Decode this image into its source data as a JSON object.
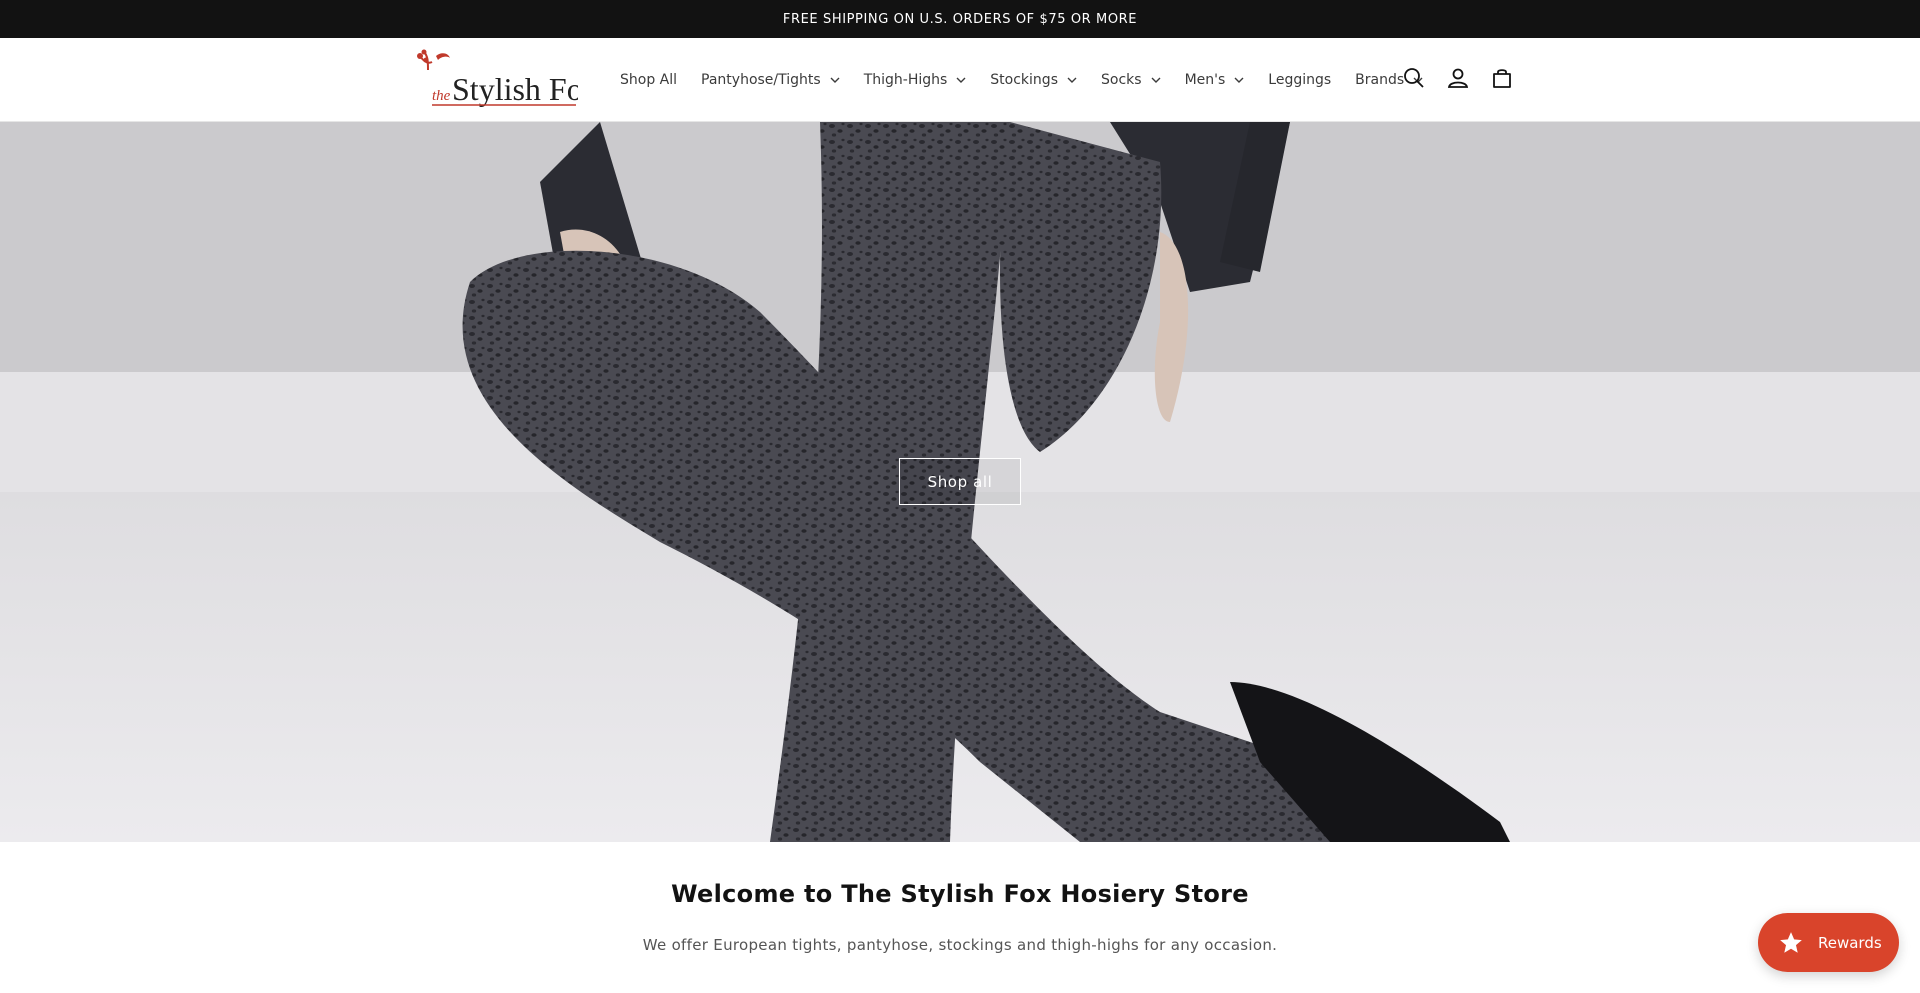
{
  "announcement": {
    "text": "FREE SHIPPING ON U.S. ORDERS OF $75 OR MORE"
  },
  "header": {
    "logo": {
      "word_small": "the",
      "word_main": "Stylish Fox",
      "accent_color": "#c0392b"
    },
    "nav": [
      {
        "label": "Shop All",
        "has_dropdown": false
      },
      {
        "label": "Pantyhose/Tights",
        "has_dropdown": true
      },
      {
        "label": "Thigh-Highs",
        "has_dropdown": true
      },
      {
        "label": "Stockings",
        "has_dropdown": true
      },
      {
        "label": "Socks",
        "has_dropdown": true
      },
      {
        "label": "Men's",
        "has_dropdown": true
      },
      {
        "label": "Leggings",
        "has_dropdown": false
      },
      {
        "label": "Brands",
        "has_dropdown": true
      }
    ],
    "icons": [
      "search-icon",
      "account-icon",
      "cart-icon"
    ]
  },
  "hero": {
    "button_label": "Shop all"
  },
  "welcome": {
    "title": "Welcome to The Stylish Fox Hosiery Store",
    "text": "We offer European tights, pantyhose, stockings and thigh-highs for any occasion."
  },
  "rewards": {
    "label": "Rewards",
    "color": "#d9442b"
  }
}
